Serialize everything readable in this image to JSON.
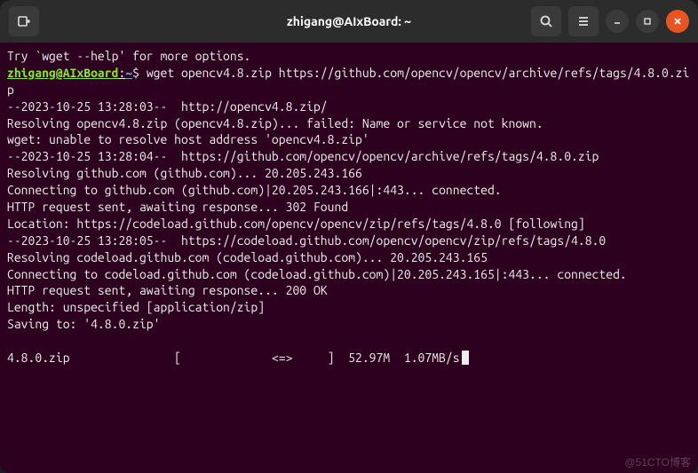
{
  "titlebar": {
    "title": "zhigang@AIxBoard: ~"
  },
  "terminal": {
    "help_line": "Try `wget --help' for more options.",
    "prompt": {
      "user_host": "zhigang@AIxBoard",
      "path": "~",
      "sep": ":",
      "dollar": "$"
    },
    "command": " wget opencv4.8.zip https://github.com/opencv/opencv/archive/refs/tags/4.8.0.zip",
    "lines": [
      "--2023-10-25 13:28:03--  http://opencv4.8.zip/",
      "Resolving opencv4.8.zip (opencv4.8.zip)... failed: Name or service not known.",
      "wget: unable to resolve host address 'opencv4.8.zip'",
      "--2023-10-25 13:28:04--  https://github.com/opencv/opencv/archive/refs/tags/4.8.0.zip",
      "Resolving github.com (github.com)... 20.205.243.166",
      "Connecting to github.com (github.com)|20.205.243.166|:443... connected.",
      "HTTP request sent, awaiting response... 302 Found",
      "Location: https://codeload.github.com/opencv/opencv/zip/refs/tags/4.8.0 [following]",
      "--2023-10-25 13:28:05--  https://codeload.github.com/opencv/opencv/zip/refs/tags/4.8.0",
      "Resolving codeload.github.com (codeload.github.com)... 20.205.243.165",
      "Connecting to codeload.github.com (codeload.github.com)|20.205.243.165|:443... connected.",
      "HTTP request sent, awaiting response... 200 OK",
      "Length: unspecified [application/zip]",
      "Saving to: '4.8.0.zip'",
      "",
      "4.8.0.zip               [             <=>     ]  52.97M  1.07MB/s"
    ]
  },
  "watermark": "@51CTO博客"
}
